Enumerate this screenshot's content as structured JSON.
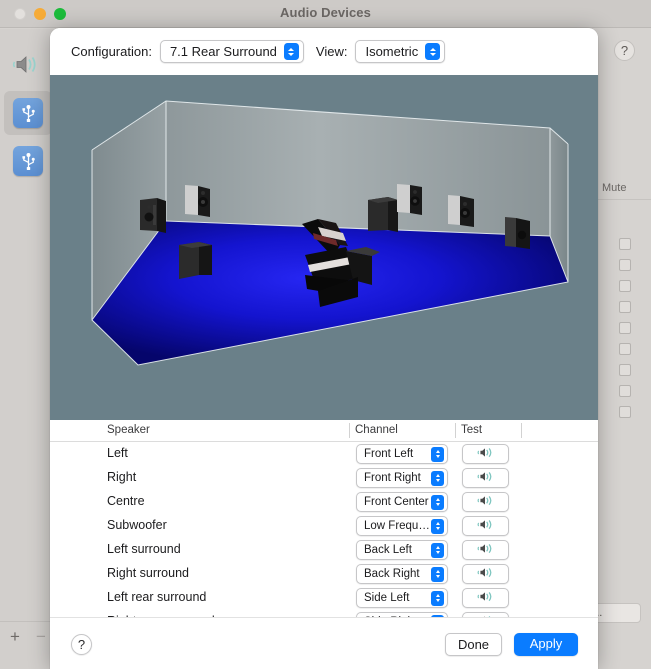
{
  "window": {
    "title": "Audio Devices",
    "traffic_lights": [
      "close",
      "minimize",
      "zoom"
    ]
  },
  "background_window": {
    "sidebar": {
      "items": [
        {
          "icon": "speaker-icon",
          "selected": false
        },
        {
          "icon": "usb-icon",
          "selected": true
        },
        {
          "icon": "usb-icon",
          "selected": false
        }
      ],
      "add_label": "+",
      "remove_label": "−"
    },
    "help_label": "?",
    "mute_column_header": "Mute",
    "checkbox_count": 9,
    "bottom_button_label": "rs..."
  },
  "sheet": {
    "toolbar": {
      "configuration_label": "Configuration:",
      "configuration_value": "7.1 Rear Surround",
      "view_label": "View:",
      "view_value": "Isometric"
    },
    "room": {
      "floor_color": "#0a0aa8",
      "wall_color": "#9aa3a6",
      "backdrop_color": "#6a8089",
      "speaker_color": "#141414"
    },
    "table": {
      "columns": [
        "Speaker",
        "Channel",
        "Test"
      ],
      "rows": [
        {
          "speaker": "Left",
          "channel": "Front Left",
          "test_icon": "speaker-wave-icon"
        },
        {
          "speaker": "Right",
          "channel": "Front Right",
          "test_icon": "speaker-wave-icon"
        },
        {
          "speaker": "Centre",
          "channel": "Front Center",
          "test_icon": "speaker-wave-icon"
        },
        {
          "speaker": "Subwoofer",
          "channel": "Low Freque…",
          "test_icon": "speaker-wave-icon"
        },
        {
          "speaker": "Left surround",
          "channel": "Back Left",
          "test_icon": "speaker-wave-icon"
        },
        {
          "speaker": "Right surround",
          "channel": "Back Right",
          "test_icon": "speaker-wave-icon"
        },
        {
          "speaker": "Left rear surround",
          "channel": "Side Left",
          "test_icon": "speaker-wave-icon"
        },
        {
          "speaker": "Right rear surround",
          "channel": "Side Right",
          "test_icon": "speaker-wave-icon"
        }
      ]
    },
    "footer": {
      "help_label": "?",
      "done_label": "Done",
      "apply_label": "Apply",
      "apply_color": "#0a7cff"
    }
  }
}
